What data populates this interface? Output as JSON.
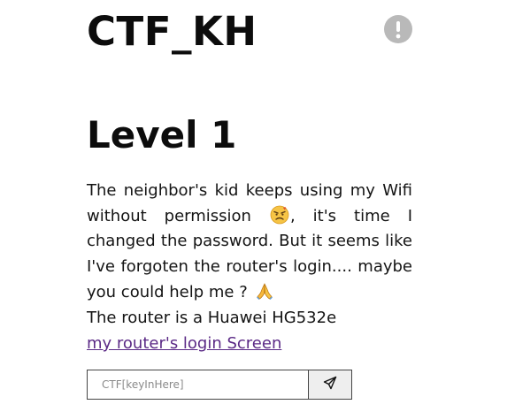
{
  "header": {
    "site_title": "CTF_KH",
    "info_icon": "exclamation-circle-icon"
  },
  "challenge": {
    "level_title": "Level 1",
    "description_part1": "The neighbor's kid keeps using my Wifi without permission ",
    "description_part2": ", it's time I changed the password. But it seems like I've forgoten the router's login.... maybe you could help me ? ",
    "router_line": "The router is a Huawei HG532e",
    "login_link": "my router's login Screen"
  },
  "form": {
    "key_placeholder": "CTF[keyInHere]",
    "key_value": "",
    "submit_icon": "send-paper-plane-icon"
  },
  "colors": {
    "link": "#5b2a86",
    "icon_gray": "#b9b9b9",
    "button_bg": "#eeeeee",
    "emoji_face": "#f6c445",
    "emoji_anger": "#e0542b"
  }
}
